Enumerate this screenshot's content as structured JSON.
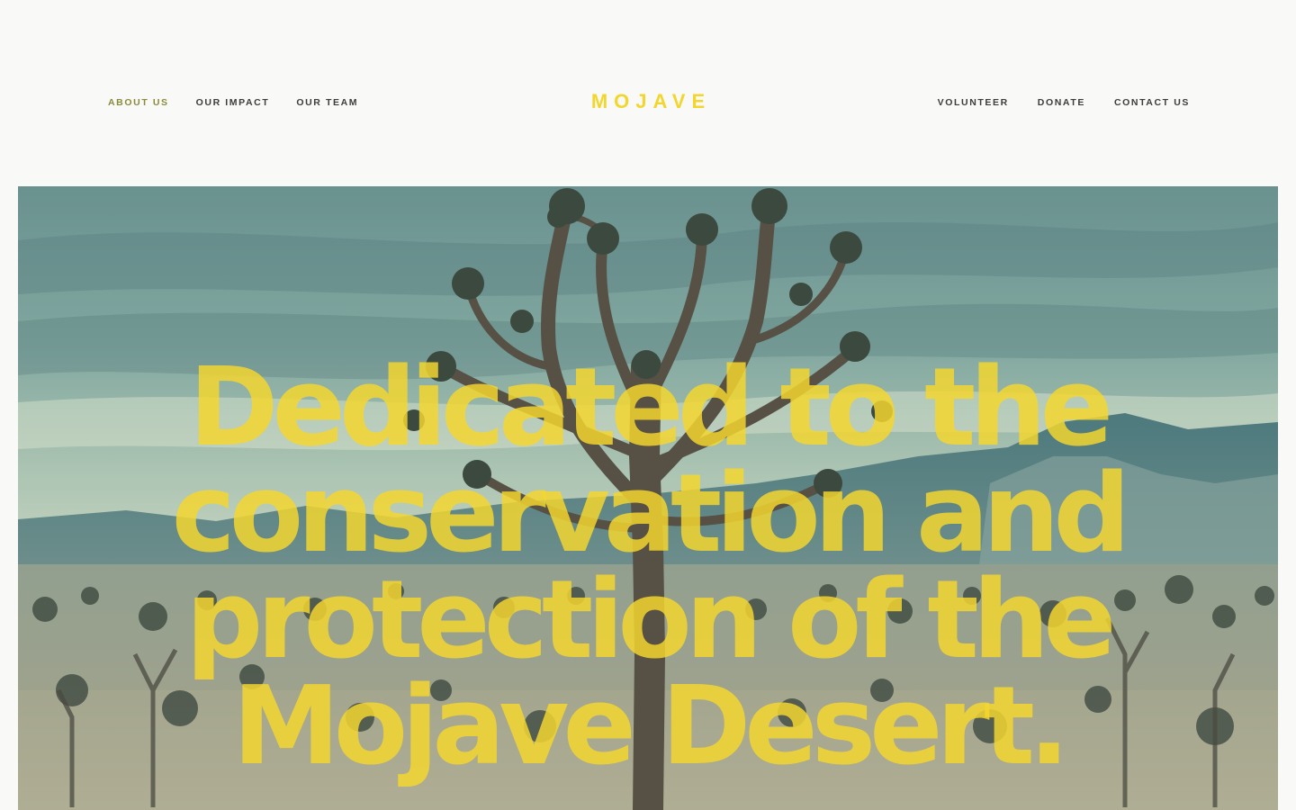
{
  "brand": {
    "logo_text": "MOJAVE",
    "accent_color": "#f2d62e",
    "active_nav_color": "#8a8a3c"
  },
  "nav": {
    "left": [
      {
        "label": "ABOUT US",
        "active": true
      },
      {
        "label": "OUR IMPACT"
      },
      {
        "label": "OUR TEAM"
      }
    ],
    "right": [
      {
        "label": "VOLUNTEER"
      },
      {
        "label": "DONATE"
      },
      {
        "label": "CONTACT US"
      }
    ]
  },
  "hero": {
    "image": "joshua-tree-desert-landscape",
    "headline_lines": [
      "Dedicated to the",
      "conservation and",
      "protection of the",
      "Mojave Desert."
    ]
  }
}
